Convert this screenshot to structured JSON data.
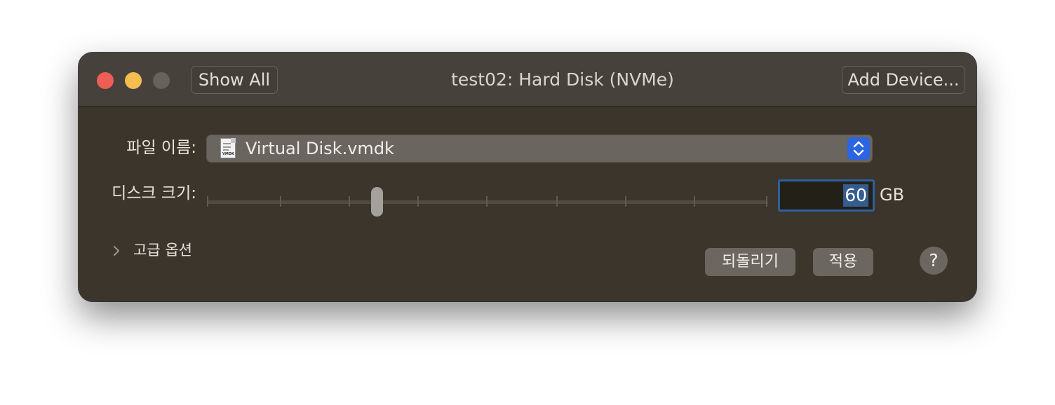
{
  "window": {
    "title": "test02: Hard Disk (NVMe)"
  },
  "toolbar": {
    "show_all_label": "Show All",
    "add_device_label": "Add Device..."
  },
  "file": {
    "label": "파일 이름:",
    "selected_value": "Virtual Disk.vmdk",
    "icon_tag": "VMDK"
  },
  "disk_size": {
    "label": "디스크 크기:",
    "value": "60",
    "unit": "GB",
    "slider_fraction": 0.3
  },
  "advanced": {
    "label": "고급 옵션"
  },
  "buttons": {
    "revert_label": "되돌리기",
    "apply_label": "적용",
    "help_label": "?"
  },
  "colors": {
    "accent": "#2b65e2",
    "focus_ring": "#305f9b",
    "window_background": "#3b352c",
    "titlebar_background": "#46413b"
  },
  "icons": {
    "close": "close-traffic-light",
    "minimize": "minimize-traffic-light",
    "zoom": "zoom-traffic-light",
    "file": "vmdk-document-icon",
    "popup_arrows": "chevron-up-down-icon",
    "disclosure": "chevron-right-icon",
    "help": "question-mark-icon"
  }
}
